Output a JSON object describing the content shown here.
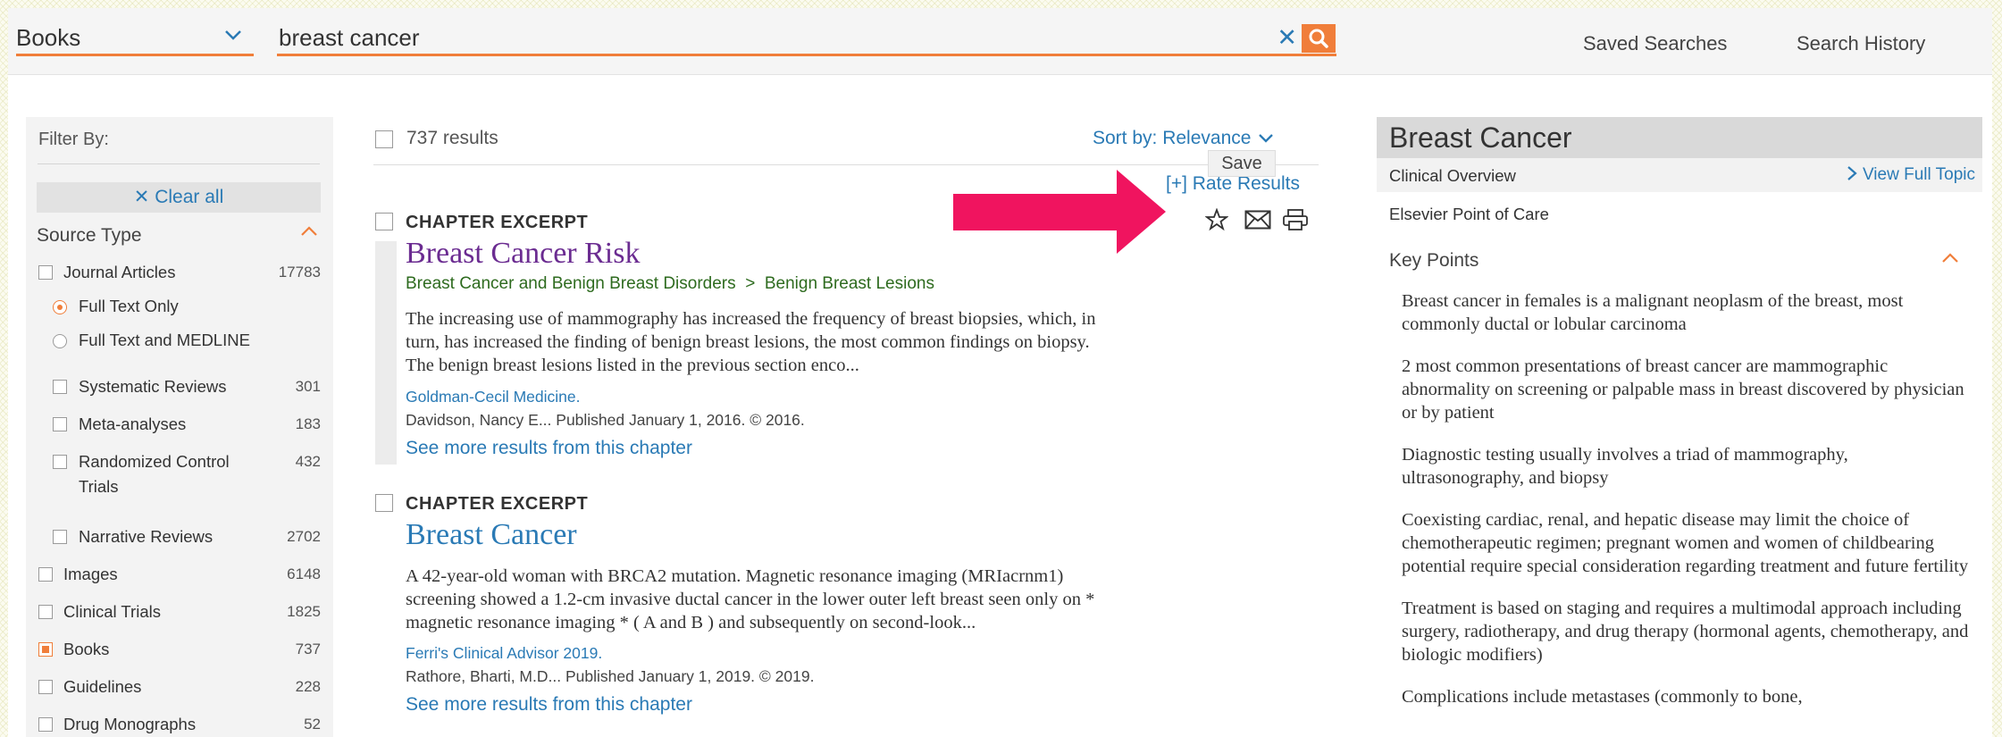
{
  "search": {
    "category": "Books",
    "query": "breast cancer"
  },
  "header": {
    "saved_searches": "Saved Searches",
    "search_history": "Search History"
  },
  "filters": {
    "title": "Filter By:",
    "clear_all": "Clear all",
    "source_type_label": "Source Type",
    "items": [
      {
        "label": "Journal Articles",
        "count": "17783",
        "checked": false
      },
      {
        "label": "Full Text Only",
        "selected": true
      },
      {
        "label": "Full Text and MEDLINE",
        "selected": false
      },
      {
        "label": "Systematic Reviews",
        "count": "301",
        "checked": false
      },
      {
        "label": "Meta-analyses",
        "count": "183",
        "checked": false
      },
      {
        "label": "Randomized Control",
        "label2": "Trials",
        "count": "432",
        "checked": false
      },
      {
        "label": "Narrative Reviews",
        "count": "2702",
        "checked": false
      },
      {
        "label": "Images",
        "count": "6148",
        "checked": false
      },
      {
        "label": "Clinical Trials",
        "count": "1825",
        "checked": false
      },
      {
        "label": "Books",
        "count": "737",
        "checked": true
      },
      {
        "label": "Guidelines",
        "count": "228",
        "checked": false
      },
      {
        "label": "Drug Monographs",
        "count": "52",
        "checked": false
      }
    ]
  },
  "results": {
    "count_label": "737 results",
    "sort_label": "Sort by: Relevance",
    "rate_results": "[+] Rate Results",
    "save_tooltip": "Save",
    "items": [
      {
        "type": "CHAPTER EXCERPT",
        "title": "Breast Cancer Risk",
        "breadcrumb": [
          "Breast Cancer and Benign Breast Disorders",
          "Benign Breast Lesions"
        ],
        "abstract_lines": [
          "The increasing use of mammography has increased the frequency of breast biopsies, which, in",
          "turn, has increased the finding of benign breast lesions, the most common findings on biopsy.",
          "The benign breast lesions listed in the previous section enco..."
        ],
        "source": "Goldman-Cecil Medicine.",
        "authors": "Davidson, Nancy E... Published January 1, 2016. © 2016.",
        "more": "See more results from this chapter"
      },
      {
        "type": "CHAPTER EXCERPT",
        "title": "Breast Cancer",
        "abstract_lines": [
          "A 42-year-old woman with BRCA2 mutation. Magnetic resonance imaging (MRIacrnm1)",
          "screening showed a 1.2-cm invasive ductal cancer in the lower outer left breast seen only on *",
          "magnetic resonance imaging * ( A and B ) and subsequently on second-look..."
        ],
        "source": "Ferri's Clinical Advisor 2019.",
        "authors": "Rathore, Bharti, M.D... Published January 1, 2019. © 2019.",
        "more": "See more results from this chapter"
      }
    ]
  },
  "topic_panel": {
    "title": "Breast Cancer",
    "subtitle": "Clinical Overview",
    "view_full": "View Full Topic",
    "source": "Elsevier Point of Care",
    "key_points_label": "Key Points",
    "key_points": [
      "Breast cancer in females is a malignant neoplasm of the breast, most commonly ductal or lobular carcinoma",
      "2 most common presentations of breast cancer are mammographic abnormality on screening or palpable mass in breast discovered by physician or by patient",
      "Diagnostic testing usually involves a triad of mammography, ultrasonography, and biopsy",
      "Coexisting cardiac, renal, and hepatic disease may limit the choice of chemotherapeutic regimen; pregnant women and women of childbearing potential require special consideration regarding treatment and future fertility",
      "Treatment is based on staging and requires a multimodal approach including surgery, radiotherapy, and drug therapy (hormonal agents, chemotherapy, and biologic modifiers)",
      "Complications include metastases (commonly to bone,"
    ]
  },
  "colors": {
    "accent_orange": "#f07e3a",
    "link_blue": "#2a7ab5",
    "visited_purple": "#6b2c91",
    "annotation_pink": "#f0145f"
  }
}
